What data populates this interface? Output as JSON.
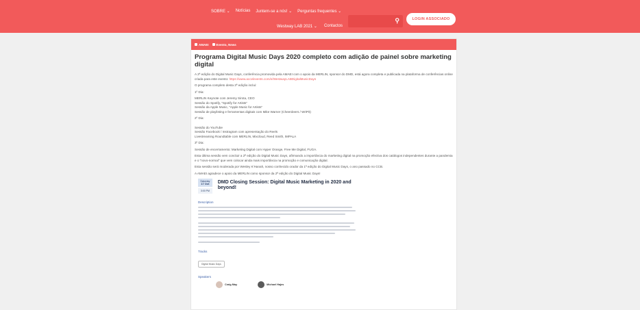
{
  "nav": {
    "row1": [
      "SOBRE ⌄",
      "Notícias",
      "Juntem-se a nós! ⌄",
      "Perguntas frequentes ⌄"
    ],
    "row2": [
      "Westway LAB 2021 ⌄",
      "Contactos"
    ],
    "login": "LOGIN ASSOCIADO"
  },
  "meta": {
    "author": "AMAEI",
    "categories": "Evento, News"
  },
  "article": {
    "title": "Programa Digital Music Days 2020 completo com adição de painel sobre marketing digital",
    "intro": "A 2ª edição do Digital Music Days, conferência promovida pela AMAEI com o apoio da MERLIN, sponsor do DMD, está agora completa e publicada na plataforma de conferências online criada para este evento: ",
    "intro_link": "https://www.accelevents.com/e/WestwayLABDigitalMusicDays",
    "program_intro": "O programa completo desta 2ª edição inclui:",
    "day1_label": "1º Dia:",
    "day1_items": [
      "MERLIN Keynote com Jeremy Sirota, CEO",
      "Sessão do Spotify, \"Spotify for Artists\"",
      "Sessão da Apple Music, \"Apple Music for Artists\"",
      "Sessão de playlisting e ferramentas digitais com Mike Warner (Cheerdeers / WriPit)"
    ],
    "day2_label": "2º Dia:",
    "day2_items": [
      "Sessão do YouTube",
      "Sessão Facebook / Instragram com apresentação do Reels",
      "Livestreaming Roundtable com MERLIN, Mixcloud, Reed Smith, IMPALA"
    ],
    "day3_label": "3º Dia:",
    "day3_items": [
      "Sessão de encerramento: Marketing Digital com Hyper Orange, Free Me Digital, FUGA."
    ],
    "closing1": "Esta última sessão vem concluir a 2ª edição do Digital Music Days, afirmando a importância do marketing digital na promoção efectiva dos catálogos independentes durante a pandemia e o \"novo-normal\" que vem colocar ainda mais importância na promoção e comunicação digital.",
    "closing2": "Esta sessão será moderada por Wesley K'Hanah, nosso conhecido orador da 1ª edição do Digital Music Days, o ano passado no CCB.",
    "closing3": "A AMAEI agradece o apoio da MERLIN como sponsor da 2ª edição do Digital Music Days!"
  },
  "session": {
    "weekday": "Saturday",
    "day": "17 Oct",
    "time": "3:00 PM",
    "title": "DMD Closing Session: Digital Music Marketing in 2020 and beyond!",
    "description_label": "Description",
    "tracks_label": "Tracks",
    "track_chip": "Digital Music Days",
    "speakers_label": "Speakers",
    "speakers": [
      "Craig May",
      "Michael Hajes"
    ]
  }
}
